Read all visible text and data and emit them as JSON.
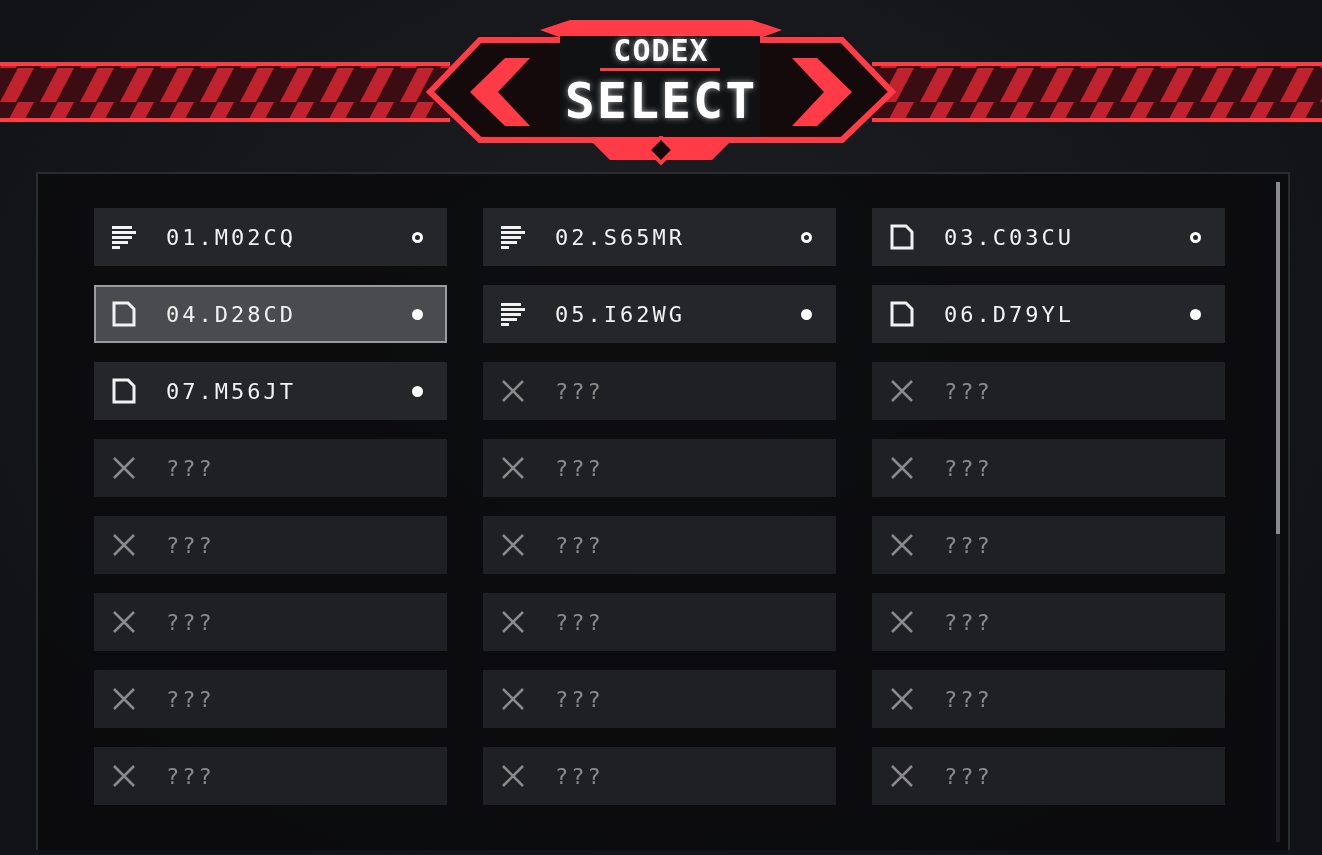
{
  "header": {
    "title": "CODEX",
    "subtitle": "SELECT"
  },
  "entries": [
    {
      "kind": "text",
      "label": "01.M02CQ",
      "viewed": false,
      "selected": false
    },
    {
      "kind": "text",
      "label": "02.S65MR",
      "viewed": false,
      "selected": false
    },
    {
      "kind": "doc",
      "label": "03.C03CU",
      "viewed": false,
      "selected": false
    },
    {
      "kind": "doc",
      "label": "04.D28CD",
      "viewed": true,
      "selected": true
    },
    {
      "kind": "text",
      "label": "05.I62WG",
      "viewed": true,
      "selected": false
    },
    {
      "kind": "doc",
      "label": "06.D79YL",
      "viewed": true,
      "selected": false
    },
    {
      "kind": "doc",
      "label": "07.M56JT",
      "viewed": true,
      "selected": false
    },
    {
      "kind": "locked",
      "label": "???",
      "selected": false
    },
    {
      "kind": "locked",
      "label": "???",
      "selected": false
    },
    {
      "kind": "locked",
      "label": "???",
      "selected": false
    },
    {
      "kind": "locked",
      "label": "???",
      "selected": false
    },
    {
      "kind": "locked",
      "label": "???",
      "selected": false
    },
    {
      "kind": "locked",
      "label": "???",
      "selected": false
    },
    {
      "kind": "locked",
      "label": "???",
      "selected": false
    },
    {
      "kind": "locked",
      "label": "???",
      "selected": false
    },
    {
      "kind": "locked",
      "label": "???",
      "selected": false
    },
    {
      "kind": "locked",
      "label": "???",
      "selected": false
    },
    {
      "kind": "locked",
      "label": "???",
      "selected": false
    },
    {
      "kind": "locked",
      "label": "???",
      "selected": false
    },
    {
      "kind": "locked",
      "label": "???",
      "selected": false
    },
    {
      "kind": "locked",
      "label": "???",
      "selected": false
    },
    {
      "kind": "locked",
      "label": "???",
      "selected": false
    },
    {
      "kind": "locked",
      "label": "???",
      "selected": false
    },
    {
      "kind": "locked",
      "label": "???",
      "selected": false
    }
  ]
}
